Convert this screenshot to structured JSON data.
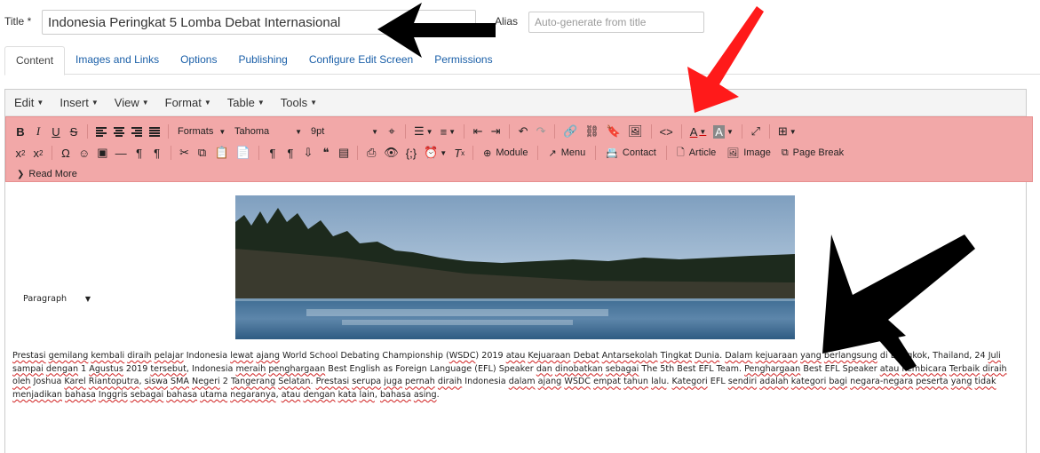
{
  "title_field": {
    "label": "Title",
    "required_mark": "*",
    "value": "Indonesia Peringkat 5 Lomba Debat Internasional"
  },
  "alias_field": {
    "label": "Alias",
    "placeholder": "Auto-generate from title"
  },
  "tabs": [
    {
      "label": "Content",
      "active": true
    },
    {
      "label": "Images and Links"
    },
    {
      "label": "Options"
    },
    {
      "label": "Publishing"
    },
    {
      "label": "Configure Edit Screen"
    },
    {
      "label": "Permissions"
    }
  ],
  "menubar": [
    "Edit",
    "Insert",
    "View",
    "Format",
    "Table",
    "Tools"
  ],
  "toolbar": {
    "formats": "Formats",
    "block_format": "Paragraph",
    "font_family": "Tahoma",
    "font_size": "9pt",
    "module_label": "Module",
    "menu_label": "Menu",
    "contact_label": "Contact",
    "article_label": "Article",
    "image_label": "Image",
    "page_break_label": "Page Break",
    "read_more_label": "Read More",
    "highlight_color": "#f2a8a8"
  },
  "content": {
    "paragraph": "Prestasi gemilang kembali diraih pelajar Indonesia lewat ajang World School Debating Championship (WSDC) 2019 atau Kejuaraan Debat Antarsekolah Tingkat Dunia. Dalam kejuaraan yang berlangsung di Bangkok, Thailand, 24 Juli sampai dengan 1 Agustus 2019 tersebut, Indonesia meraih penghargaan Best English as Foreign Language (EFL) Speaker dan dinobatkan sebagai The 5th Best EFL Team. Penghargaan Best EFL Speaker atau Pembicara Terbaik diraih oleh Joshua Karel Riantoputra, siswa SMA Negeri 2 Tangerang Selatan. Prestasi serupa juga pernah diraih Indonesia dalam ajang WSDC empat tahun lalu. Kategori EFL sendiri adalah kategori bagi negara-negara peserta yang tidak menjadikan bahasa Inggris sebagai bahasa utama negaranya, atau dengan kata lain, bahasa asing.",
    "misspelled_words": [
      "Prestasi",
      "gemilang",
      "kembali",
      "diraih",
      "pelajar",
      "lewat",
      "ajang",
      "WSDC",
      "atau",
      "Kejuaraan",
      "Debat",
      "Antarsekolah",
      "Tingkat",
      "Dunia",
      "Dalam",
      "kejuaraan",
      "yang",
      "berlangsung",
      "Juli",
      "sampai",
      "dengan",
      "Agustus",
      "tersebut",
      "meraih",
      "penghargaan",
      "dan",
      "dinobatkan",
      "sebagai",
      "Penghargaan",
      "Pembicara",
      "Terbaik",
      "oleh",
      "Karel",
      "Riantoputra",
      "siswa",
      "SMA",
      "Negeri",
      "Tangerang",
      "Selatan",
      "serupa",
      "juga",
      "pernah",
      "dalam",
      "empat",
      "tahun",
      "lalu",
      "Kategori",
      "sendiri",
      "adalah",
      "kategori",
      "bagi",
      "negara-negara",
      "peserta",
      "tidak",
      "menjadikan",
      "bahasa",
      "Inggris",
      "utama",
      "negaranya",
      "kata",
      "lain",
      "asing"
    ]
  },
  "annotation_colors": {
    "black_arrow": "#000000",
    "red_arrow": "#ff1a1a"
  }
}
